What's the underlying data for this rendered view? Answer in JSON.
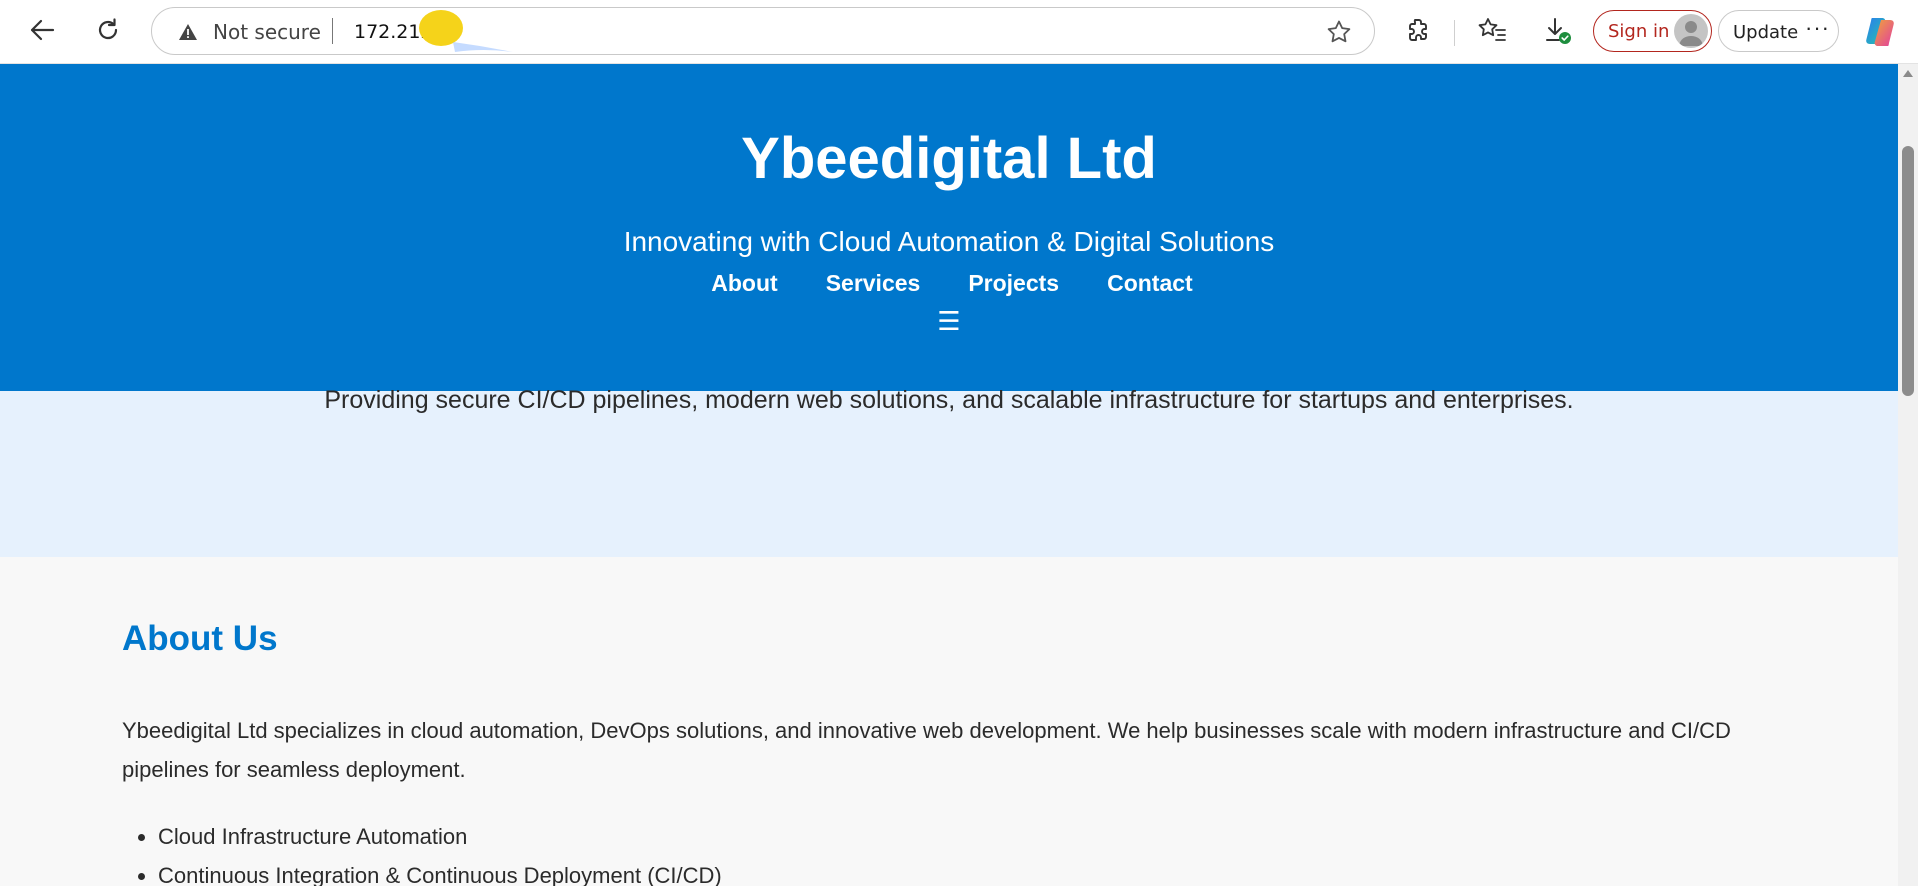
{
  "browser": {
    "security_label": "Not secure",
    "url": "172.212",
    "signin_label": "Sign in",
    "update_label": "Update",
    "more_label": "···"
  },
  "hero": {
    "title": "Ybeedigital Ltd",
    "tagline": "Innovating with Cloud Automation & Digital Solutions",
    "nav": [
      "About",
      "Services",
      "Projects",
      "Contact"
    ],
    "menu_glyph": "☰"
  },
  "band": {
    "text": "Providing secure CI/CD pipelines, modern web solutions, and scalable infrastructure for startups and enterprises."
  },
  "about": {
    "heading": "About Us",
    "body": "Ybeedigital Ltd specializes in cloud automation, DevOps solutions, and innovative web development. We help businesses scale with modern infrastructure and CI/CD pipelines for seamless deployment.",
    "items": [
      "Cloud Infrastructure Automation",
      "Continuous Integration & Continuous Deployment (CI/CD)"
    ]
  },
  "colors": {
    "brand": "#0077cc",
    "band": "#e6f1fd",
    "signin": "#b3261e"
  },
  "icons": [
    "back-icon",
    "refresh-icon",
    "warning-icon",
    "favorite-star-icon",
    "extensions-icon",
    "favorites-icon",
    "downloads-icon",
    "profile-avatar-icon",
    "copilot-icon",
    "menu-icon"
  ]
}
